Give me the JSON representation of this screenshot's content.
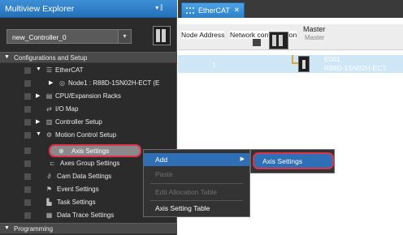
{
  "explorer": {
    "title": "Multiview Explorer",
    "pin_glyph": "▾ ⫿",
    "close_glyph": "✕",
    "controller": {
      "value": "new_Controller_0",
      "arrow": "▾"
    },
    "tree": [
      {
        "id": "configurations",
        "label": "Configurations and Setup",
        "section": true
      },
      {
        "id": "ethercat",
        "label": "EtherCAT"
      },
      {
        "id": "node1",
        "label": "Node1 : R88D-1SN02H-ECT (E"
      },
      {
        "id": "cpu-racks",
        "label": "CPU/Expansion Racks"
      },
      {
        "id": "io-map",
        "label": "I/O Map"
      },
      {
        "id": "controller-setup",
        "label": "Controller Setup"
      },
      {
        "id": "motion-control",
        "label": "Motion Control Setup"
      },
      {
        "id": "axis-settings",
        "label": "Axis Settings"
      },
      {
        "id": "axes-group",
        "label": "Axes Group Settings"
      },
      {
        "id": "cam-data",
        "label": "Cam Data Settings"
      },
      {
        "id": "event-settings",
        "label": "Event Settings"
      },
      {
        "id": "task-settings",
        "label": "Task Settings"
      },
      {
        "id": "data-trace",
        "label": "Data Trace Settings"
      },
      {
        "id": "programming",
        "label": "Programming",
        "section": true
      }
    ]
  },
  "editor": {
    "tab_label": "EtherCAT",
    "tab_close": "✕",
    "column_headers": [
      "Node Address",
      "Network configuration"
    ],
    "master": {
      "label": "Master",
      "sublabel": "Master"
    },
    "node": {
      "number": "1",
      "name": "E001",
      "model": "R88D-1SN02H-ECT"
    }
  },
  "context_menu": {
    "items": [
      {
        "label": "Add",
        "enabled": true,
        "submenu": true
      },
      {
        "label": "Paste",
        "enabled": false
      },
      {
        "label": "Edit Allocation Table",
        "enabled": false
      },
      {
        "label": "Axis Setting Table",
        "enabled": true
      }
    ],
    "submenu_arrow": "▶",
    "submenu": {
      "item": "Axis Settings"
    }
  },
  "colors": {
    "highlight_outline": "#e0324b",
    "selection": "#2f6fb5",
    "title_bar": "#2370b8",
    "panel": "#2b2b2b"
  }
}
